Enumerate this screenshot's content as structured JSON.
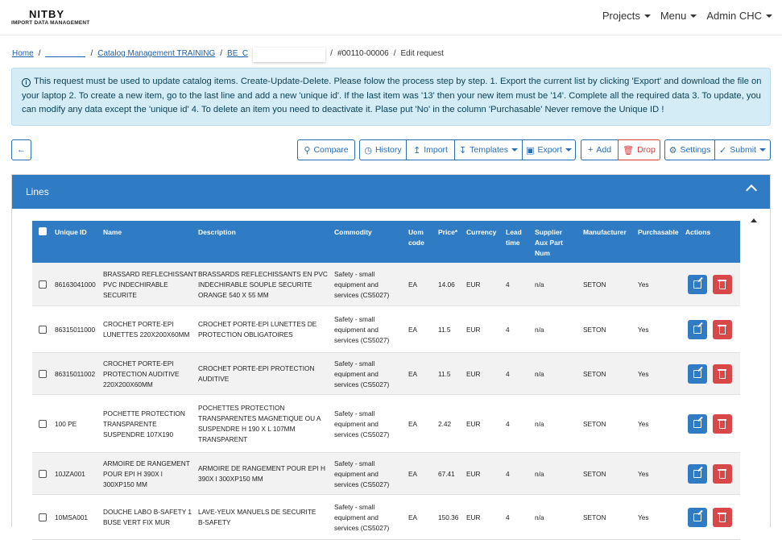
{
  "header": {
    "logo_text": "NITBY",
    "logo_subtitle": "IMPORT DATA MANAGEMENT",
    "nav": [
      {
        "label": "Projects"
      },
      {
        "label": "Menu"
      },
      {
        "label": "Admin CHC"
      }
    ]
  },
  "breadcrumb": {
    "home": "Home",
    "catalog": "Catalog Management TRAINING",
    "be": "BE_C",
    "request": "#00110-00006",
    "current": "Edit request"
  },
  "alert": {
    "text": "This request must be used to update catalog items. Create-Update-Delete. Please folow the process step by step. 1. Export the current list by clicking 'Export' and download the file on your laptop 2. To create a new item, go to the last line and add a new 'unique id'. If the last item was '13' then your new item must be '14'. Complete all the required data 3. To update, you can modify any data except the 'unique id' 4. To delete an item you need to deactivate it. Plase put 'No' in the column 'Purchasable' Never remove the Unique ID !"
  },
  "toolbar": {
    "compare": "Compare",
    "history": "History",
    "import": "Import",
    "templates": "Templates",
    "export": "Export",
    "add": "Add",
    "drop": "Drop",
    "settings": "Settings",
    "submit": "Submit"
  },
  "panel": {
    "title": "Lines"
  },
  "table": {
    "headers": {
      "unique_id": "Unique ID",
      "name": "Name",
      "description": "Description",
      "commodity": "Commodity",
      "uom1": "Uom",
      "uom2": "code",
      "price": "Price*",
      "currency": "Currency",
      "lead1": "Lead",
      "lead2": "time",
      "sup1": "Supplier",
      "sup2": "Aux Part",
      "sup3": "Num",
      "manufacturer": "Manufacturer",
      "purchasable": "Purchasable",
      "actions": "Actions"
    },
    "rows": [
      {
        "id": "86163041000",
        "name": [
          "BRASSARD REFLECHISSANT",
          "PVC INDECHIRABLE",
          "SECURITE"
        ],
        "desc": [
          "BRASSARDS REFLECHISSANTS EN PVC",
          "INDECHIRABLE SOUPLE SECURITE",
          "ORANGE 540 X 55 MM"
        ],
        "commodity": [
          "Safety - small",
          "equipment and",
          "services (CS5027)"
        ],
        "uom": "EA",
        "price": "14.06",
        "currency": "EUR",
        "lead": "4",
        "sup": "n/a",
        "manufacturer": "SETON",
        "purchasable": "Yes"
      },
      {
        "id": "86315011000",
        "name": [
          "CROCHET PORTE-EPI",
          "LUNETTES 220X200X60MM"
        ],
        "desc": [
          "CROCHET PORTE-EPI LUNETTES DE",
          "PROTECTION OBLIGATOIRES"
        ],
        "commodity": [
          "Safety - small",
          "equipment and",
          "services (CS5027)"
        ],
        "uom": "EA",
        "price": "11.5",
        "currency": "EUR",
        "lead": "4",
        "sup": "n/a",
        "manufacturer": "SETON",
        "purchasable": "Yes"
      },
      {
        "id": "86315011002",
        "name": [
          "CROCHET PORTE-EPI",
          "PROTECTION AUDITIVE",
          "220X200X60MM"
        ],
        "desc": [
          "CROCHET PORTE-EPI PROTECTION",
          "AUDITIVE"
        ],
        "commodity": [
          "Safety - small",
          "equipment and",
          "services (CS5027)"
        ],
        "uom": "EA",
        "price": "11.5",
        "currency": "EUR",
        "lead": "4",
        "sup": "n/a",
        "manufacturer": "SETON",
        "purchasable": "Yes"
      },
      {
        "id": "100 PE",
        "name": [
          "POCHETTE PROTECTION",
          "TRANSPARENTE",
          "SUSPENDRE 107X190"
        ],
        "desc": [
          "POCHETTES PROTECTION",
          "TRANSPARENTES MAGNETIQUE OU A",
          "SUSPENDRE H 190 X L 107MM",
          "TRANSPARENT"
        ],
        "commodity": [
          "Safety - small",
          "equipment and",
          "services (CS5027)"
        ],
        "uom": "EA",
        "price": "2.42",
        "currency": "EUR",
        "lead": "4",
        "sup": "n/a",
        "manufacturer": "SETON",
        "purchasable": "Yes"
      },
      {
        "id": "10JZA001",
        "name": [
          "ARMOIRE DE RANGEMENT",
          "POUR EPI H 390X l",
          "300XP150 MM"
        ],
        "desc": [
          "ARMOIRE DE RANGEMENT POUR EPI H",
          "390X l 300XP150 MM"
        ],
        "commodity": [
          "Safety - small",
          "equipment and",
          "services (CS5027)"
        ],
        "uom": "EA",
        "price": "67.41",
        "currency": "EUR",
        "lead": "4",
        "sup": "n/a",
        "manufacturer": "SETON",
        "purchasable": "Yes"
      },
      {
        "id": "10MSA001",
        "name": [
          "DOUCHE LABO B-SAFETY 1",
          "BUSE VERT FIX MUR"
        ],
        "desc": [
          "LAVE-YEUX MANUELS DE SECURITE",
          "B-SAFETY"
        ],
        "commodity": [
          "Safety - small",
          "equipment and",
          "services (CS5027)"
        ],
        "uom": "EA",
        "price": "150.36",
        "currency": "EUR",
        "lead": "4",
        "sup": "n/a",
        "manufacturer": "SETON",
        "purchasable": "Yes"
      }
    ]
  }
}
